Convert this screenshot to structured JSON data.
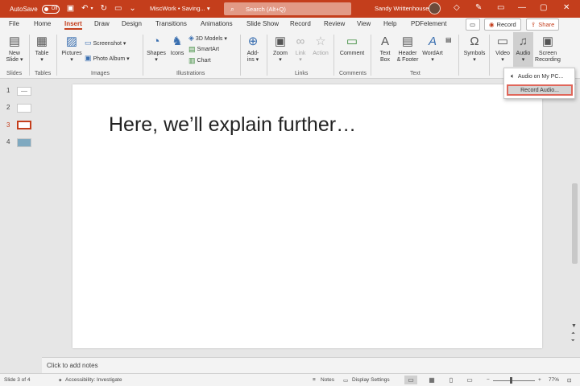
{
  "titlebar": {
    "autosave_label": "AutoSave",
    "autosave_state": "Off",
    "doc_title": "MiscWork • Saving... ▾",
    "search_placeholder": "Search (Alt+Q)",
    "user_name": "Sandy Writtenhouse"
  },
  "tabs": [
    "File",
    "Home",
    "Insert",
    "Draw",
    "Design",
    "Transitions",
    "Animations",
    "Slide Show",
    "Record",
    "Review",
    "View",
    "Help",
    "PDFelement"
  ],
  "active_tab": "Insert",
  "tab_buttons": {
    "record": "Record",
    "share": "Share"
  },
  "ribbon": {
    "new_slide": [
      "New",
      "Slide ▾"
    ],
    "table": [
      "Table",
      "▾"
    ],
    "pictures": [
      "Pictures",
      "▾"
    ],
    "screenshot": "Screenshot ▾",
    "photo_album": "Photo Album ▾",
    "shapes": [
      "Shapes",
      "▾"
    ],
    "icons": "Icons",
    "models_3d": "3D Models ▾",
    "smartart": "SmartArt",
    "chart": "Chart",
    "addins": [
      "Add-",
      "ins ▾"
    ],
    "zoom": [
      "Zoom",
      "▾"
    ],
    "link": [
      "Link",
      "▾"
    ],
    "action": "Action",
    "comment": "Comment",
    "text_box": [
      "Text",
      "Box"
    ],
    "header_footer": [
      "Header",
      "& Footer"
    ],
    "wordart": [
      "WordArt",
      "▾"
    ],
    "symbols": [
      "Symbols",
      "▾"
    ],
    "video": [
      "Video",
      "▾"
    ],
    "audio": [
      "Audio",
      "▾"
    ],
    "screen_recording": [
      "Screen",
      "Recording"
    ],
    "groups": [
      "Slides",
      "Tables",
      "Images",
      "Illustrations",
      "Links",
      "Comments",
      "Text"
    ]
  },
  "audio_menu": {
    "items": [
      "Audio on My PC...",
      "Record Audio..."
    ]
  },
  "thumbnails": [
    "1",
    "2",
    "3",
    "4"
  ],
  "current_slide_index": 3,
  "slide": {
    "text": "Here, we’ll explain further…"
  },
  "notes": {
    "placeholder": "Click to add notes"
  },
  "status": {
    "slide_info": "Slide 3 of 4",
    "accessibility": "Accessibility: Investigate",
    "notes": "Notes",
    "display_settings": "Display Settings",
    "zoom": "77%"
  }
}
